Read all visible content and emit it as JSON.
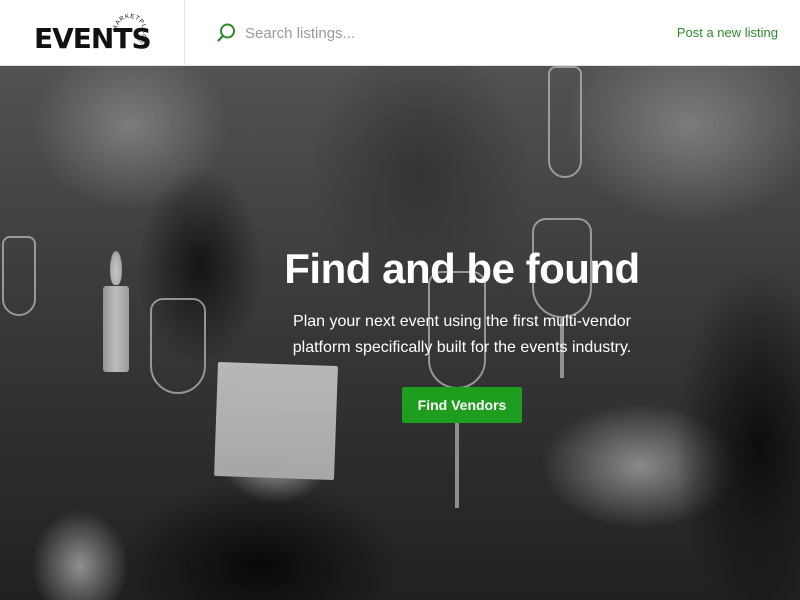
{
  "header": {
    "logo_text": "EVENTS",
    "logo_ring_text": "MARKETPLACE",
    "search_placeholder": "Search listings...",
    "post_link": "Post a new listing"
  },
  "hero": {
    "title": "Find and be found",
    "subtitle": "Plan your next event using the first multi-vendor platform specifically built for the events industry.",
    "cta": "Find Vendors"
  },
  "colors": {
    "accent": "#1f9d1f",
    "link": "#2c8a2c"
  },
  "icons": {
    "search": "search-icon"
  }
}
